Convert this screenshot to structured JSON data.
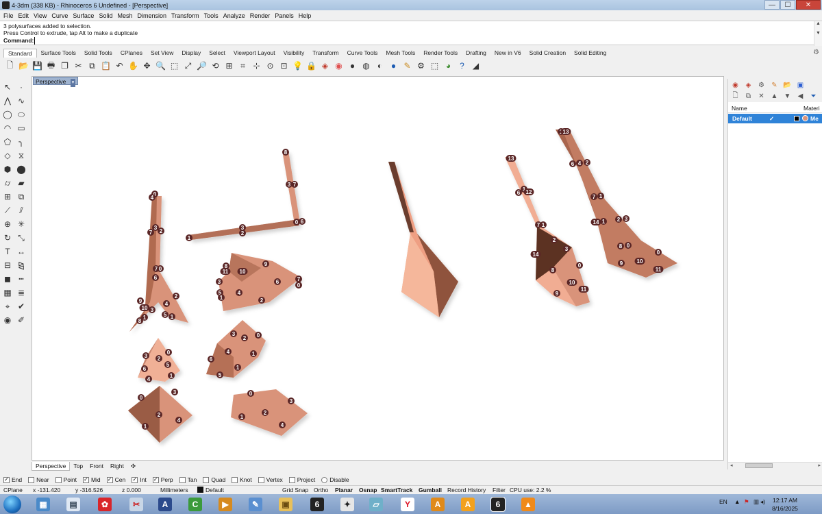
{
  "window": {
    "title": "4-3dm (338 KB) - Rhinoceros 6 Undefined - [Perspective]",
    "minimize": "—",
    "maximize": "☐",
    "close": "✕"
  },
  "menu": [
    "File",
    "Edit",
    "View",
    "Curve",
    "Surface",
    "Solid",
    "Mesh",
    "Dimension",
    "Transform",
    "Tools",
    "Analyze",
    "Render",
    "Panels",
    "Help"
  ],
  "command_history": [
    "3 polysurfaces added to selection.",
    "Press Control to extrude, tap Alt to make a duplicate"
  ],
  "command_prompt": "Command:",
  "toolbar_tabs": [
    "Standard",
    "Surface Tools",
    "Solid Tools",
    "CPlanes",
    "Set View",
    "Display",
    "Select",
    "Viewport Layout",
    "Visibility",
    "Transform",
    "Curve Tools",
    "Mesh Tools",
    "Render Tools",
    "Drafting",
    "New in V6",
    "Solid Creation",
    "Solid Editing"
  ],
  "viewport": {
    "name": "Perspective",
    "tabs": [
      "Perspective",
      "Top",
      "Front",
      "Right"
    ]
  },
  "layers_panel": {
    "col_name": "Name",
    "col_material": "Materi",
    "layer_name": "Default",
    "layer_check": "✓",
    "layer_material": "Me"
  },
  "osnaps": [
    {
      "label": "End",
      "checked": true
    },
    {
      "label": "Near",
      "checked": false
    },
    {
      "label": "Point",
      "checked": false
    },
    {
      "label": "Mid",
      "checked": true
    },
    {
      "label": "Cen",
      "checked": true
    },
    {
      "label": "Int",
      "checked": true
    },
    {
      "label": "Perp",
      "checked": true
    },
    {
      "label": "Tan",
      "checked": false
    },
    {
      "label": "Quad",
      "checked": false
    },
    {
      "label": "Knot",
      "checked": false
    },
    {
      "label": "Vertex",
      "checked": false
    },
    {
      "label": "Project",
      "checked": false
    },
    {
      "label": "Disable",
      "checked": false
    }
  ],
  "status": {
    "cplane": "CPlane",
    "x": "x -131.420",
    "y": "y -316.526",
    "z": "z 0.000",
    "units": "Millimeters",
    "layer": "Default",
    "grid_snap": "Grid Snap",
    "ortho": "Ortho",
    "planar": "Planar",
    "osnap": "Osnap",
    "smarttrack": "SmartTrack",
    "gumball": "Gumball",
    "record_history": "Record History",
    "filter": "Filter",
    "cpu": "CPU use: 2.2 %"
  },
  "taskbar": {
    "language": "EN",
    "time": "12:17 AM",
    "date": "8/16/2025"
  },
  "scene_labels": [
    "0",
    "1",
    "2",
    "3",
    "4",
    "5",
    "6",
    "7",
    "8",
    "9",
    "10",
    "11",
    "12",
    "13",
    "14"
  ],
  "colors": {
    "copper": "#d9937a",
    "copper_light": "#f2b29a",
    "copper_dark": "#8a5744",
    "label_bg": "#5a2626",
    "selection_blue": "#2f83d8"
  }
}
